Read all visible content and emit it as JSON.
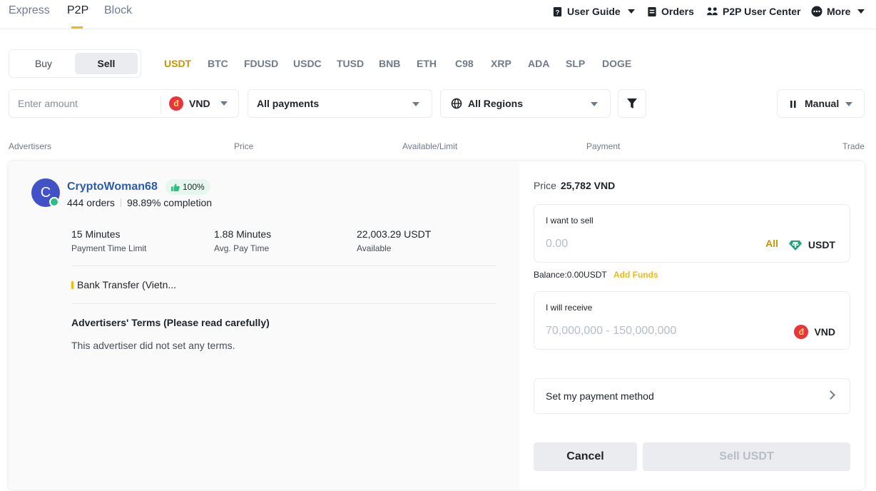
{
  "nav": {
    "tabs": [
      {
        "label": "Express"
      },
      {
        "label": "P2P"
      },
      {
        "label": "Block"
      }
    ],
    "links": {
      "user_guide": "User Guide",
      "orders": "Orders",
      "user_center": "P2P User Center",
      "more": "More"
    }
  },
  "trade_side": {
    "buy": "Buy",
    "sell": "Sell",
    "active": "Sell"
  },
  "coins": [
    "USDT",
    "BTC",
    "FDUSD",
    "USDC",
    "TUSD",
    "BNB",
    "ETH",
    "C98",
    "XRP",
    "ADA",
    "SLP",
    "DOGE"
  ],
  "active_coin": "USDT",
  "filters": {
    "amount_placeholder": "Enter amount",
    "currency": "VND",
    "currency_icon": "đ",
    "payments": "All payments",
    "regions": "All Regions",
    "sort": "Manual"
  },
  "table_headers": {
    "advertisers": "Advertisers",
    "price": "Price",
    "available": "Available/Limit",
    "payment": "Payment",
    "trade": "Trade"
  },
  "advertiser": {
    "avatar_letter": "C",
    "name": "CryptoWoman68",
    "rating": "100%",
    "orders": "444 orders",
    "completion": "98.89% completion",
    "payment_time_value": "15 Minutes",
    "payment_time_label": "Payment Time Limit",
    "avg_pay_value": "1.88 Minutes",
    "avg_pay_label": "Avg. Pay Time",
    "available_value": "22,003.29 USDT",
    "available_label": "Available",
    "payment_method": "Bank Transfer (Vietn...",
    "terms_title": "Advertisers' Terms (Please read carefully)",
    "terms_body": "This advertiser did not set any terms."
  },
  "order_panel": {
    "price_label": "Price",
    "price_value": "25,782 VND",
    "sell_caption": "I want to sell",
    "sell_value": "0.00",
    "all_label": "All",
    "sell_unit": "USDT",
    "balance_label": "Balance:",
    "balance_value": "0.00USDT",
    "add_funds": "Add Funds",
    "receive_caption": "I will receive",
    "receive_value": "70,000,000 - 150,000,000",
    "receive_unit": "VND",
    "receive_icon": "đ",
    "payment_method_label": "Set my payment method",
    "cancel": "Cancel",
    "sell_button": "Sell USDT"
  },
  "colors": {
    "accent": "#f0b90b",
    "link": "#2b5cad",
    "online": "#2ebd85",
    "coin_active": "#c99400"
  }
}
